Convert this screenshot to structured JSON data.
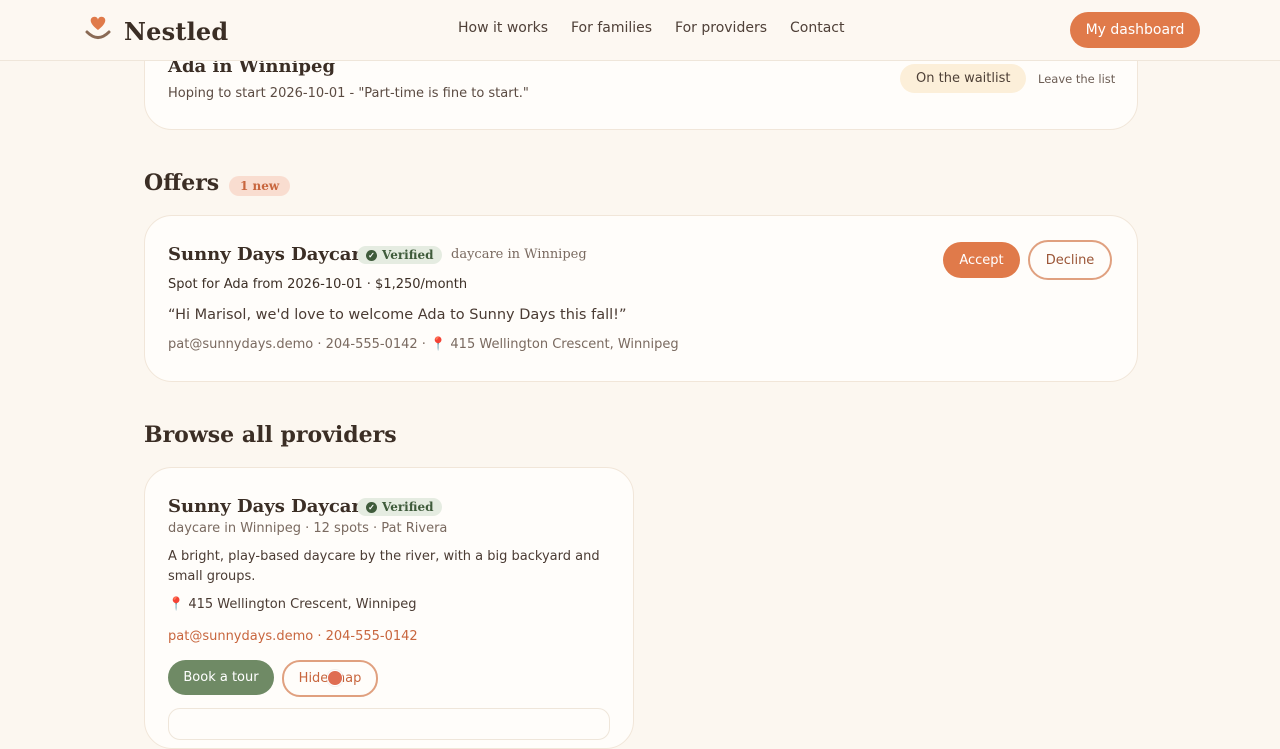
{
  "header": {
    "brand": "Nestled",
    "nav": [
      "How it works",
      "For families",
      "For providers",
      "Contact"
    ],
    "dashboard_label": "My dashboard"
  },
  "waitlist": {
    "title": "Ada in Winnipeg",
    "subtitle": "Hoping to start 2026-10-01 - \"Part-time is fine to start.\"",
    "status": "On the waitlist",
    "leave_label": "Leave the list"
  },
  "offers": {
    "heading": "Offers",
    "badge": "1 new",
    "card": {
      "name": "Sunny Days Daycare",
      "verified": "Verified",
      "type": "daycare in Winnipeg",
      "spot": "Spot for Ada from 2026-10-01 · $1,250/month",
      "message": "“Hi Marisol, we'd love to welcome Ada to Sunny Days this fall!”",
      "contact": "pat@sunnydays.demo · 204-555-0142 ·",
      "address": "415 Wellington Crescent, Winnipeg",
      "accept_label": "Accept",
      "decline_label": "Decline"
    }
  },
  "browse": {
    "heading": "Browse all providers",
    "card": {
      "name": "Sunny Days Daycare",
      "verified": "Verified",
      "meta": "daycare in Winnipeg · 12 spots · Pat Rivera",
      "desc1": "A bright, play-based daycare by the river, with a big backyard and",
      "desc2": "small groups.",
      "address": "415 Wellington Crescent, Winnipeg",
      "contact": "pat@sunnydays.demo · 204-555-0142",
      "tour_label": "Book a tour",
      "hide_label": "Hide map"
    }
  },
  "colors": {
    "accent": "#e07a4a",
    "background": "#fcf7f0",
    "verified_bg": "#e5ece1",
    "tour_green": "#6f8a65"
  },
  "icons": [
    "heart-smile-logo-icon",
    "check-circle-icon",
    "pin-icon"
  ]
}
